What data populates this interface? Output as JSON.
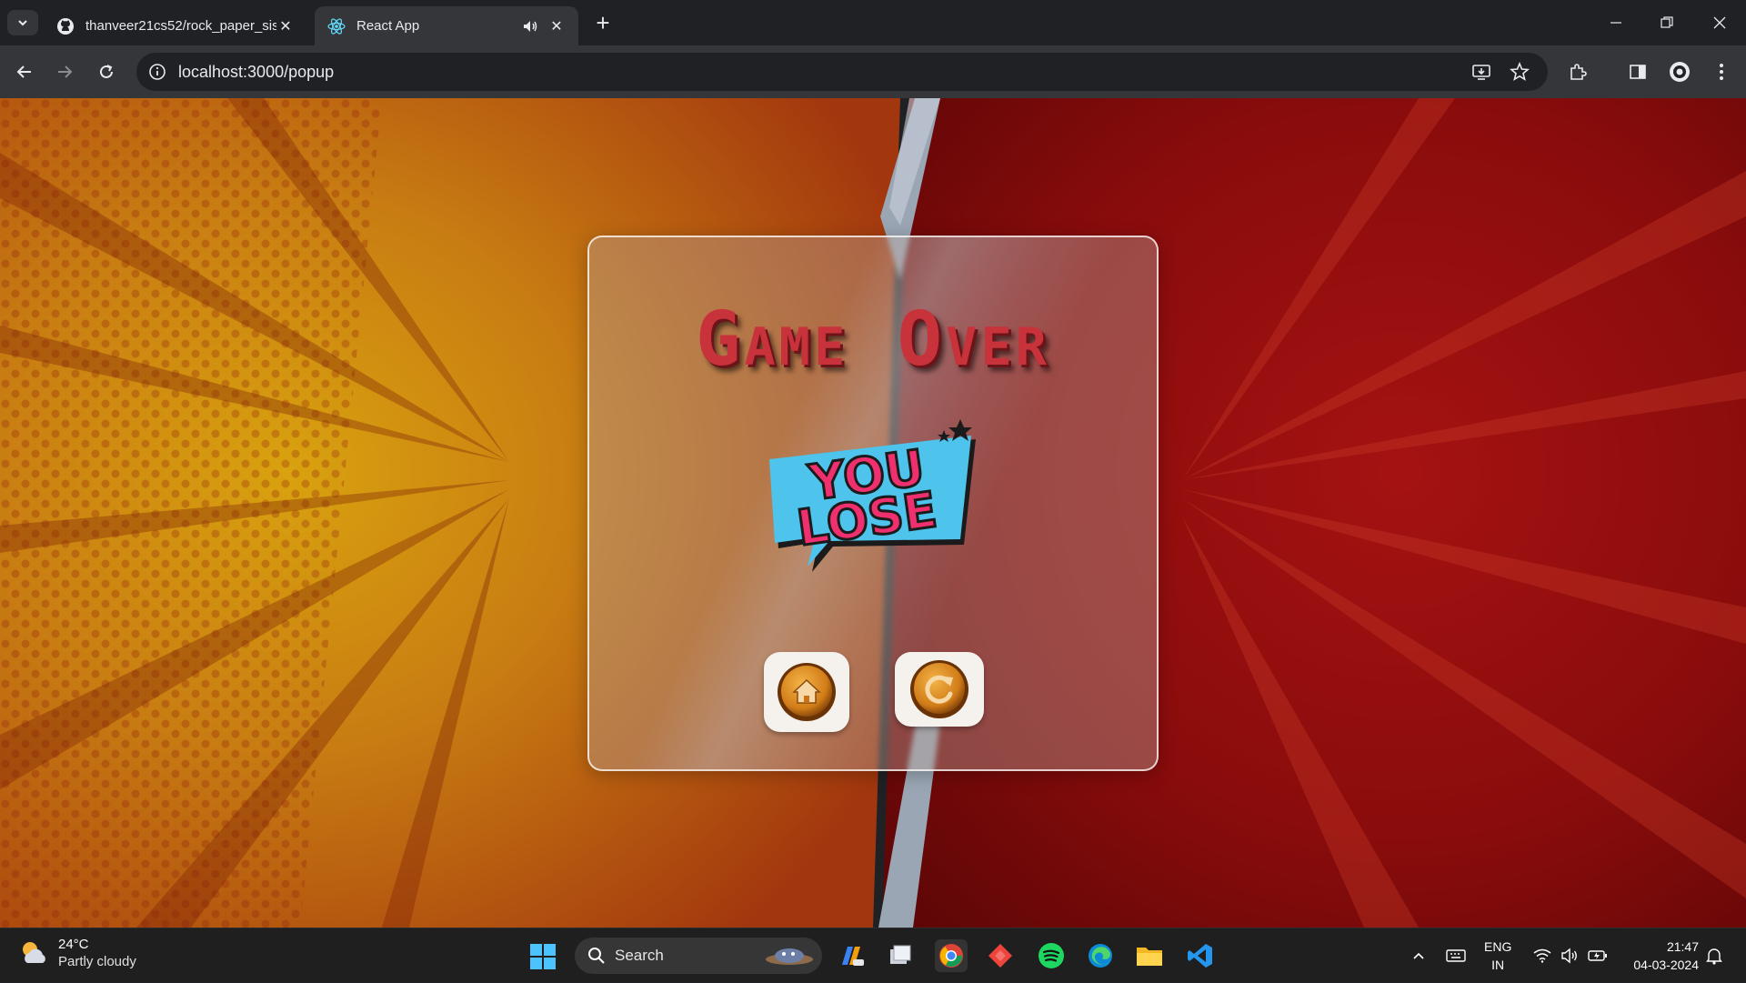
{
  "browser": {
    "tabs": [
      {
        "title": "thanveer21cs52/rock_paper_sis",
        "active": false,
        "icon": "github-icon"
      },
      {
        "title": "React App",
        "active": true,
        "icon": "react-icon",
        "audio": true
      }
    ],
    "url": "localhost:3000/popup"
  },
  "page": {
    "heading": "Game Over",
    "result_text_line1": "YOU",
    "result_text_line2": "LOSE",
    "buttons": [
      {
        "name": "home",
        "icon": "home-icon"
      },
      {
        "name": "replay",
        "icon": "replay-icon"
      }
    ],
    "colors": {
      "left_bg": "#c27a10",
      "right_bg": "#8e0f0f",
      "title": "#c8333b",
      "button_coin": "#d98a1c"
    }
  },
  "taskbar": {
    "weather": {
      "temp": "24°C",
      "desc": "Partly cloudy"
    },
    "search_label": "Search",
    "lang_line1": "ENG",
    "lang_line2": "IN",
    "time": "21:47",
    "date": "04-03-2024"
  }
}
